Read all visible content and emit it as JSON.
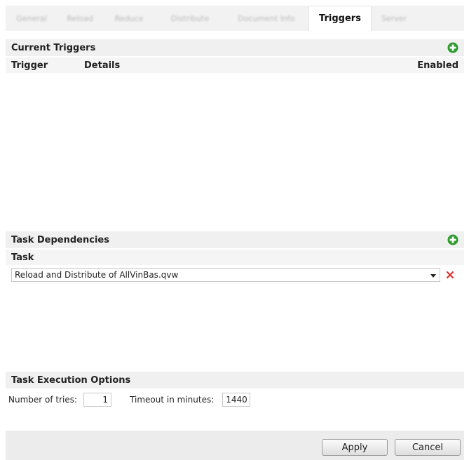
{
  "tabs": {
    "items": [
      {
        "label": "General"
      },
      {
        "label": "Reload"
      },
      {
        "label": "Reduce"
      },
      {
        "label": "Distribute"
      },
      {
        "label": "Document Info"
      },
      {
        "label": "Triggers"
      },
      {
        "label": "Server"
      }
    ],
    "active": "Triggers"
  },
  "current_triggers": {
    "title": "Current Triggers",
    "add_icon": "green-plus-icon",
    "columns": {
      "trigger": "Trigger",
      "details": "Details",
      "enabled": "Enabled"
    },
    "rows": []
  },
  "task_dependencies": {
    "title": "Task Dependencies",
    "add_icon": "green-plus-icon",
    "column": "Task",
    "selected_task": "Reload and Distribute of AllVinBas.qvw",
    "remove_icon": "red-x-icon"
  },
  "execution_options": {
    "title": "Task Execution Options",
    "tries_label": "Number of tries:",
    "tries_value": "1",
    "timeout_label": "Timeout in minutes:",
    "timeout_value": "1440"
  },
  "footer": {
    "apply_label": "Apply",
    "cancel_label": "Cancel"
  },
  "colors": {
    "add_green": "#2e9b2e",
    "remove_red": "#d9302a",
    "header_bg": "#f0f0f0"
  }
}
